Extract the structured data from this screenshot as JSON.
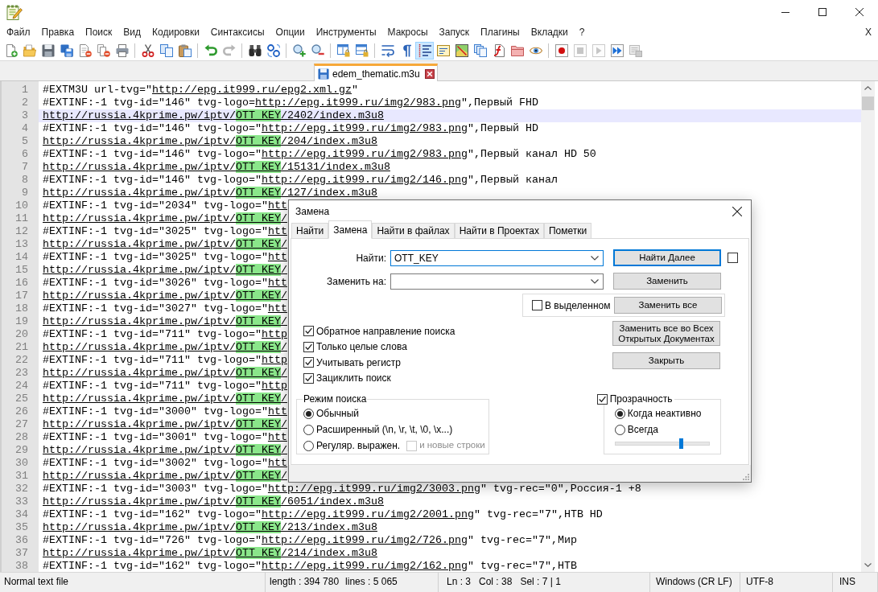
{
  "menu": {
    "items": [
      "Файл",
      "Правка",
      "Поиск",
      "Вид",
      "Кодировки",
      "Синтаксисы",
      "Опции",
      "Инструменты",
      "Макросы",
      "Запуск",
      "Плагины",
      "Вкладки",
      "?"
    ],
    "close_label": "X"
  },
  "toolbar": [
    [
      {
        "kind": "new",
        "pressed": false,
        "disabled": false
      },
      {
        "kind": "open",
        "pressed": false,
        "disabled": false
      },
      {
        "kind": "save",
        "pressed": false,
        "disabled": false
      },
      {
        "kind": "saveall",
        "pressed": false,
        "disabled": false
      },
      {
        "kind": "close",
        "pressed": false,
        "disabled": false
      },
      {
        "kind": "closeall",
        "pressed": false,
        "disabled": false
      },
      {
        "kind": "print",
        "pressed": false,
        "disabled": false
      }
    ],
    [
      {
        "kind": "cut",
        "pressed": false,
        "disabled": false
      },
      {
        "kind": "copy",
        "pressed": false,
        "disabled": false
      },
      {
        "kind": "paste",
        "pressed": false,
        "disabled": false
      }
    ],
    [
      {
        "kind": "undo",
        "pressed": false,
        "disabled": false
      },
      {
        "kind": "redo",
        "pressed": false,
        "disabled": true
      }
    ],
    [
      {
        "kind": "find",
        "pressed": false,
        "disabled": false
      },
      {
        "kind": "replace",
        "pressed": false,
        "disabled": false
      }
    ],
    [
      {
        "kind": "zoomin",
        "pressed": false,
        "disabled": false
      },
      {
        "kind": "zoomout",
        "pressed": false,
        "disabled": false
      }
    ],
    [
      {
        "kind": "syncv",
        "pressed": false,
        "disabled": false
      },
      {
        "kind": "synch",
        "pressed": false,
        "disabled": false
      }
    ],
    [
      {
        "kind": "wrap",
        "pressed": false,
        "disabled": false
      },
      {
        "kind": "allchars",
        "pressed": false,
        "disabled": false
      },
      {
        "kind": "indent",
        "pressed": true,
        "disabled": false
      },
      {
        "kind": "udl",
        "pressed": false,
        "disabled": false
      },
      {
        "kind": "docmap",
        "pressed": false,
        "disabled": false
      },
      {
        "kind": "doclist",
        "pressed": false,
        "disabled": false
      },
      {
        "kind": "funclist",
        "pressed": false,
        "disabled": false
      },
      {
        "kind": "folder",
        "pressed": false,
        "disabled": false
      },
      {
        "kind": "monitor",
        "pressed": false,
        "disabled": false
      }
    ],
    [
      {
        "kind": "record",
        "pressed": false,
        "disabled": false
      },
      {
        "kind": "stop",
        "pressed": false,
        "disabled": true
      },
      {
        "kind": "play",
        "pressed": false,
        "disabled": true
      },
      {
        "kind": "playmulti",
        "pressed": false,
        "disabled": false
      },
      {
        "kind": "savemacro",
        "pressed": false,
        "disabled": true
      }
    ]
  ],
  "tabs": [
    {
      "label": "edem_thematic.m3u",
      "selected": true,
      "modified": false
    }
  ],
  "editor": {
    "lines": [
      {
        "number": "1",
        "current": false,
        "segments": [
          {
            "kind": "plain",
            "text": "#EXTM3U url-tvg=\""
          },
          {
            "kind": "link",
            "text": "http://epg.it999.ru/epg2.xml.gz"
          },
          {
            "kind": "plain",
            "text": "\""
          }
        ]
      },
      {
        "number": "2",
        "current": false,
        "segments": [
          {
            "kind": "plain",
            "text": "#EXTINF:-1 tvg-id=\"146\" tvg-logo="
          },
          {
            "kind": "link",
            "text": "http://epg.it999.ru/img2/983.png"
          },
          {
            "kind": "plain",
            "text": "\",Первый FHD"
          }
        ]
      },
      {
        "number": "3",
        "current": true,
        "segments": [
          {
            "kind": "link",
            "text": "http://russia.4kprime.pw/iptv/"
          },
          {
            "kind": "match",
            "text": "OTT_KEY"
          },
          {
            "kind": "link",
            "text": "/2402/index.m3u8"
          }
        ]
      },
      {
        "number": "4",
        "current": false,
        "segments": [
          {
            "kind": "plain",
            "text": "#EXTINF:-1 tvg-id=\"146\" tvg-logo=\""
          },
          {
            "kind": "link",
            "text": "http://epg.it999.ru/img2/983.png"
          },
          {
            "kind": "plain",
            "text": "\",Первый HD"
          }
        ]
      },
      {
        "number": "5",
        "current": false,
        "segments": [
          {
            "kind": "link",
            "text": "http://russia.4kprime.pw/iptv/"
          },
          {
            "kind": "match",
            "text": "OTT_KEY"
          },
          {
            "kind": "link",
            "text": "/204/index.m3u8"
          }
        ]
      },
      {
        "number": "6",
        "current": false,
        "segments": [
          {
            "kind": "plain",
            "text": "#EXTINF:-1 tvg-id=\"146\" tvg-logo=\""
          },
          {
            "kind": "link",
            "text": "http://epg.it999.ru/img2/983.png"
          },
          {
            "kind": "plain",
            "text": "\",Первый канал HD 50"
          }
        ]
      },
      {
        "number": "7",
        "current": false,
        "segments": [
          {
            "kind": "link",
            "text": "http://russia.4kprime.pw/iptv/"
          },
          {
            "kind": "match",
            "text": "OTT_KEY"
          },
          {
            "kind": "link",
            "text": "/15131/index.m3u8"
          }
        ]
      },
      {
        "number": "8",
        "current": false,
        "segments": [
          {
            "kind": "plain",
            "text": "#EXTINF:-1 tvg-id=\"146\" tvg-logo=\""
          },
          {
            "kind": "link",
            "text": "http://epg.it999.ru/img2/146.png"
          },
          {
            "kind": "plain",
            "text": "\",Первый канал"
          }
        ]
      },
      {
        "number": "9",
        "current": false,
        "segments": [
          {
            "kind": "link",
            "text": "http://russia.4kprime.pw/iptv/"
          },
          {
            "kind": "match",
            "text": "OTT_KEY"
          },
          {
            "kind": "link",
            "text": "/127/index.m3u8"
          }
        ]
      },
      {
        "number": "10",
        "current": false,
        "segments": [
          {
            "kind": "plain",
            "text": "#EXTINF:-1 tvg-id=\"2034\" tvg-logo=\""
          },
          {
            "kind": "link",
            "text": "htt"
          }
        ]
      },
      {
        "number": "11",
        "current": false,
        "segments": [
          {
            "kind": "link",
            "text": "http://russia.4kprime.pw/iptv/"
          },
          {
            "kind": "match",
            "text": "OTT_KEY"
          },
          {
            "kind": "link",
            "text": "/"
          }
        ]
      },
      {
        "number": "12",
        "current": false,
        "segments": [
          {
            "kind": "plain",
            "text": "#EXTINF:-1 tvg-id=\"3025\" tvg-logo=\""
          },
          {
            "kind": "link",
            "text": "htt"
          }
        ]
      },
      {
        "number": "13",
        "current": false,
        "segments": [
          {
            "kind": "link",
            "text": "http://russia.4kprime.pw/iptv/"
          },
          {
            "kind": "match",
            "text": "OTT_KEY"
          },
          {
            "kind": "link",
            "text": "/"
          }
        ]
      },
      {
        "number": "14",
        "current": false,
        "segments": [
          {
            "kind": "plain",
            "text": "#EXTINF:-1 tvg-id=\"3025\" tvg-logo=\""
          },
          {
            "kind": "link",
            "text": "htt"
          }
        ]
      },
      {
        "number": "15",
        "current": false,
        "segments": [
          {
            "kind": "link",
            "text": "http://russia.4kprime.pw/iptv/"
          },
          {
            "kind": "match",
            "text": "OTT_KEY"
          },
          {
            "kind": "link",
            "text": "/"
          }
        ]
      },
      {
        "number": "16",
        "current": false,
        "segments": [
          {
            "kind": "plain",
            "text": "#EXTINF:-1 tvg-id=\"3026\" tvg-logo=\""
          },
          {
            "kind": "link",
            "text": "htt"
          }
        ]
      },
      {
        "number": "17",
        "current": false,
        "segments": [
          {
            "kind": "link",
            "text": "http://russia.4kprime.pw/iptv/"
          },
          {
            "kind": "match",
            "text": "OTT_KEY"
          },
          {
            "kind": "link",
            "text": "/"
          }
        ]
      },
      {
        "number": "18",
        "current": false,
        "segments": [
          {
            "kind": "plain",
            "text": "#EXTINF:-1 tvg-id=\"3027\" tvg-logo=\""
          },
          {
            "kind": "link",
            "text": "htt"
          }
        ]
      },
      {
        "number": "19",
        "current": false,
        "segments": [
          {
            "kind": "link",
            "text": "http://russia.4kprime.pw/iptv/"
          },
          {
            "kind": "match",
            "text": "OTT_KEY"
          },
          {
            "kind": "link",
            "text": "/"
          }
        ]
      },
      {
        "number": "20",
        "current": false,
        "segments": [
          {
            "kind": "plain",
            "text": "#EXTINF:-1 tvg-id=\"711\" tvg-logo=\""
          },
          {
            "kind": "link",
            "text": "http"
          }
        ]
      },
      {
        "number": "21",
        "current": false,
        "segments": [
          {
            "kind": "link",
            "text": "http://russia.4kprime.pw/iptv/"
          },
          {
            "kind": "match",
            "text": "OTT_KEY"
          },
          {
            "kind": "link",
            "text": "/"
          }
        ]
      },
      {
        "number": "22",
        "current": false,
        "segments": [
          {
            "kind": "plain",
            "text": "#EXTINF:-1 tvg-id=\"711\" tvg-logo=\""
          },
          {
            "kind": "link",
            "text": "http"
          }
        ]
      },
      {
        "number": "23",
        "current": false,
        "segments": [
          {
            "kind": "link",
            "text": "http://russia.4kprime.pw/iptv/"
          },
          {
            "kind": "match",
            "text": "OTT_KEY"
          },
          {
            "kind": "link",
            "text": "/"
          }
        ]
      },
      {
        "number": "24",
        "current": false,
        "segments": [
          {
            "kind": "plain",
            "text": "#EXTINF:-1 tvg-id=\"711\" tvg-logo=\""
          },
          {
            "kind": "link",
            "text": "http"
          }
        ]
      },
      {
        "number": "25",
        "current": false,
        "segments": [
          {
            "kind": "link",
            "text": "http://russia.4kprime.pw/iptv/"
          },
          {
            "kind": "match",
            "text": "OTT_KEY"
          },
          {
            "kind": "link",
            "text": "/"
          }
        ]
      },
      {
        "number": "26",
        "current": false,
        "segments": [
          {
            "kind": "plain",
            "text": "#EXTINF:-1 tvg-id=\"3000\" tvg-logo=\""
          },
          {
            "kind": "link",
            "text": "htt"
          }
        ]
      },
      {
        "number": "27",
        "current": false,
        "segments": [
          {
            "kind": "link",
            "text": "http://russia.4kprime.pw/iptv/"
          },
          {
            "kind": "match",
            "text": "OTT_KEY"
          },
          {
            "kind": "link",
            "text": "/"
          }
        ]
      },
      {
        "number": "28",
        "current": false,
        "segments": [
          {
            "kind": "plain",
            "text": "#EXTINF:-1 tvg-id=\"3001\" tvg-logo=\""
          },
          {
            "kind": "link",
            "text": "htt"
          }
        ]
      },
      {
        "number": "29",
        "current": false,
        "segments": [
          {
            "kind": "link",
            "text": "http://russia.4kprime.pw/iptv/"
          },
          {
            "kind": "match",
            "text": "OTT_KEY"
          },
          {
            "kind": "link",
            "text": "/"
          }
        ]
      },
      {
        "number": "30",
        "current": false,
        "segments": [
          {
            "kind": "plain",
            "text": "#EXTINF:-1 tvg-id=\"3002\" tvg-logo=\""
          },
          {
            "kind": "link",
            "text": "htt"
          }
        ]
      },
      {
        "number": "31",
        "current": false,
        "segments": [
          {
            "kind": "link",
            "text": "http://russia.4kprime.pw/iptv/"
          },
          {
            "kind": "match",
            "text": "OTT_KEY"
          },
          {
            "kind": "link",
            "text": "/"
          }
        ]
      },
      {
        "number": "32",
        "current": false,
        "segments": [
          {
            "kind": "plain",
            "text": "#EXTINF:-1 tvg-id=\"3003\" tvg-logo=\""
          },
          {
            "kind": "link",
            "text": "http://epg.it999.ru/img2/3003.png"
          },
          {
            "kind": "plain",
            "text": "\" tvg-rec=\"0\",Россия-1 +8"
          }
        ]
      },
      {
        "number": "33",
        "current": false,
        "segments": [
          {
            "kind": "link",
            "text": "http://russia.4kprime.pw/iptv/"
          },
          {
            "kind": "match",
            "text": "OTT_KEY"
          },
          {
            "kind": "link",
            "text": "/6051/index.m3u8"
          }
        ]
      },
      {
        "number": "34",
        "current": false,
        "segments": [
          {
            "kind": "plain",
            "text": "#EXTINF:-1 tvg-id=\"162\" tvg-logo=\""
          },
          {
            "kind": "link",
            "text": "http://epg.it999.ru/img2/2001.png"
          },
          {
            "kind": "plain",
            "text": "\" tvg-rec=\"7\",НТВ HD"
          }
        ]
      },
      {
        "number": "35",
        "current": false,
        "segments": [
          {
            "kind": "link",
            "text": "http://russia.4kprime.pw/iptv/"
          },
          {
            "kind": "match",
            "text": "OTT_KEY"
          },
          {
            "kind": "link",
            "text": "/213/index.m3u8"
          }
        ]
      },
      {
        "number": "36",
        "current": false,
        "segments": [
          {
            "kind": "plain",
            "text": "#EXTINF:-1 tvg-id=\"726\" tvg-logo=\""
          },
          {
            "kind": "link",
            "text": "http://epg.it999.ru/img2/726.png"
          },
          {
            "kind": "plain",
            "text": "\" tvg-rec=\"7\",Мир"
          }
        ]
      },
      {
        "number": "37",
        "current": false,
        "segments": [
          {
            "kind": "link",
            "text": "http://russia.4kprime.pw/iptv/"
          },
          {
            "kind": "match",
            "text": "OTT_KEY"
          },
          {
            "kind": "link",
            "text": "/214/index.m3u8"
          }
        ]
      },
      {
        "number": "38",
        "current": false,
        "segments": [
          {
            "kind": "plain",
            "text": "#EXTINF:-1 tvg-id=\"162\" tvg-logo=\""
          },
          {
            "kind": "link",
            "text": "http://epg.it999.ru/img2/162.png"
          },
          {
            "kind": "plain",
            "text": "\" tvg-rec=\"7\",НТВ"
          }
        ]
      }
    ]
  },
  "dialog": {
    "title": "Замена",
    "tabs": [
      {
        "label": "Найти",
        "selected": false
      },
      {
        "label": "Замена",
        "selected": true
      },
      {
        "label": "Найти в файлах",
        "selected": false
      },
      {
        "label": "Найти в Проектах",
        "selected": false
      },
      {
        "label": "Пометки",
        "selected": false
      }
    ],
    "find": {
      "label": "Найти:",
      "value": "OTT_KEY",
      "focused": true
    },
    "replace": {
      "label": "Заменить на:",
      "focused": false
    },
    "find_next_checkbox": {
      "checked": false
    },
    "in_selection": {
      "label": "В выделенном",
      "checked": false
    },
    "buttons": [
      {
        "label": "Найти Далее",
        "default": true
      },
      {
        "label": "Заменить",
        "default": false
      },
      {
        "label": "Заменить все",
        "default": false
      },
      {
        "label": "Заменить все во Всех Открытых Документах",
        "default": false
      },
      {
        "label": "Закрыть",
        "default": false
      }
    ],
    "options": [
      {
        "label": "Обратное направление поиска",
        "checked": true
      },
      {
        "label": "Только целые слова",
        "checked": true
      },
      {
        "label": "Учитывать регистр",
        "checked": true
      },
      {
        "label": "Зациклить поиск",
        "checked": true
      }
    ],
    "search_mode": {
      "title": "Режим поиска",
      "options": [
        {
          "label": "Обычный",
          "selected": true
        },
        {
          "label": "Расширенный (\\n, \\r, \\t, \\0, \\x...)",
          "selected": false
        },
        {
          "label": "Регуляр. выражен.",
          "selected": false
        }
      ],
      "newlines": {
        "label": "и новые строки",
        "checked": false,
        "disabled": true
      }
    },
    "transparency": {
      "label": "Прозрачность",
      "checked": true,
      "options": [
        {
          "label": "Когда неактивно",
          "selected": true
        },
        {
          "label": "Всегда",
          "selected": false
        }
      ],
      "level": 0.7
    }
  },
  "status_bar": [
    [
      "Normal text file"
    ],
    [
      "length : 394 780",
      "lines : 5 065"
    ],
    [
      "Ln : 3",
      "Col : 38",
      "Sel : 7 | 1"
    ],
    [
      "Windows (CR LF)"
    ],
    [
      "UTF-8"
    ],
    [
      "INS"
    ]
  ]
}
